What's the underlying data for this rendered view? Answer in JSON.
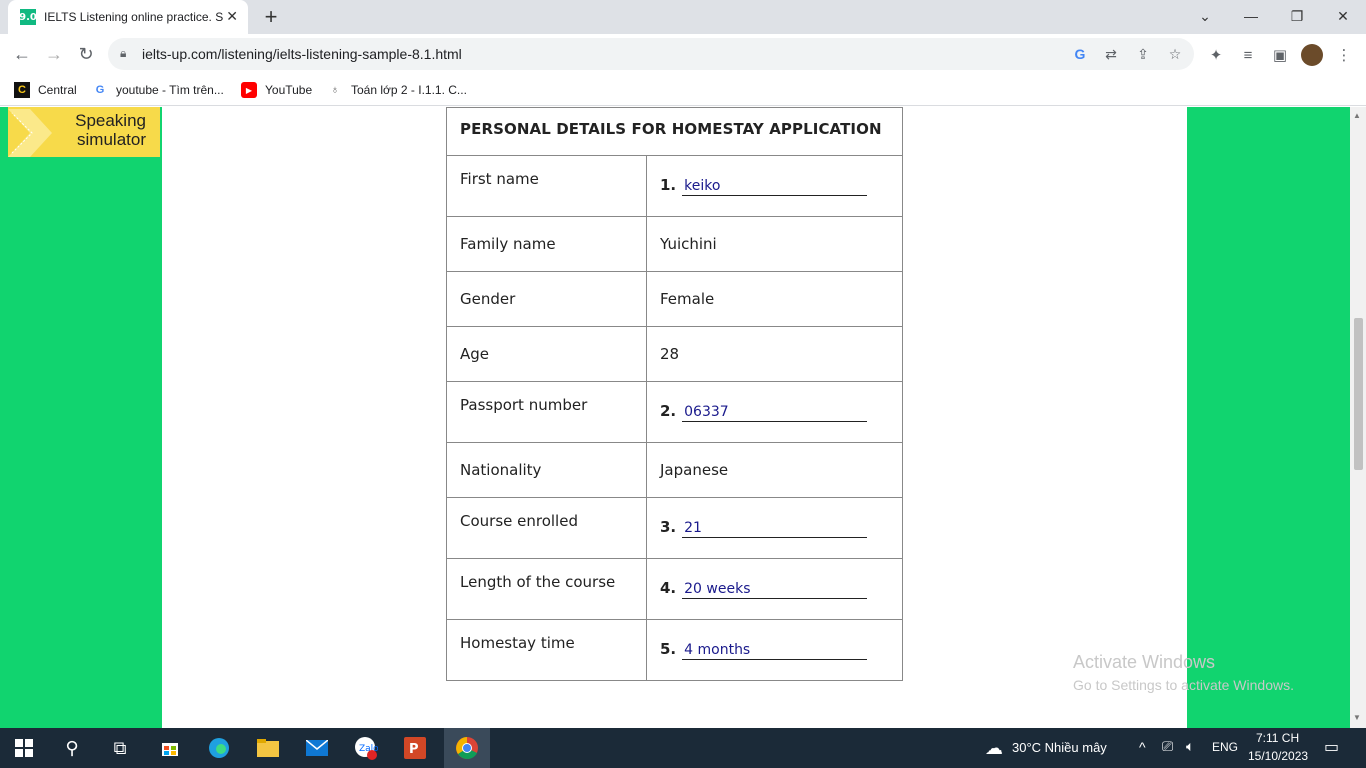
{
  "browser": {
    "tab_title": "IELTS Listening online practice. S",
    "tab_favicon": "9.0",
    "url": "ielts-up.com/listening/ielts-listening-sample-8.1.html",
    "bookmarks": [
      {
        "label": "Central",
        "icon": "central-icon"
      },
      {
        "label": "youtube - Tìm trên...",
        "icon": "google-icon"
      },
      {
        "label": "YouTube",
        "icon": "youtube-icon"
      },
      {
        "label": "Toán lớp 2 - I.1.1. C...",
        "icon": "math-icon"
      }
    ]
  },
  "sidebar": {
    "speaking_line1": "Speaking",
    "speaking_line2": "simulator"
  },
  "form": {
    "title": "PERSONAL DETAILS FOR HOMESTAY APPLICATION",
    "rows": [
      {
        "label": "First name",
        "qnum": "1.",
        "answer": "keiko"
      },
      {
        "label": "Family name",
        "value": "Yuichini"
      },
      {
        "label": "Gender",
        "value": "Female"
      },
      {
        "label": "Age",
        "value": "28"
      },
      {
        "label": "Passport number",
        "qnum": "2.",
        "answer": "06337"
      },
      {
        "label": "Nationality",
        "value": "Japanese"
      },
      {
        "label": "Course enrolled",
        "qnum": "3.",
        "answer": "21"
      },
      {
        "label": "Length of the course",
        "qnum": "4.",
        "answer": "20 weeks"
      },
      {
        "label": "Homestay time",
        "qnum": "5.",
        "answer": "4 months"
      }
    ]
  },
  "watermark": {
    "line1": "Activate Windows",
    "line2": "Go to Settings to activate Windows."
  },
  "taskbar": {
    "weather": "30°C  Nhiều mây",
    "lang": "ENG",
    "time": "7:11 CH",
    "date": "15/10/2023"
  },
  "colors": {
    "green": "#11d46f",
    "speaking_yellow": "#f7da4a",
    "answer_blue": "#1a1a8c"
  }
}
